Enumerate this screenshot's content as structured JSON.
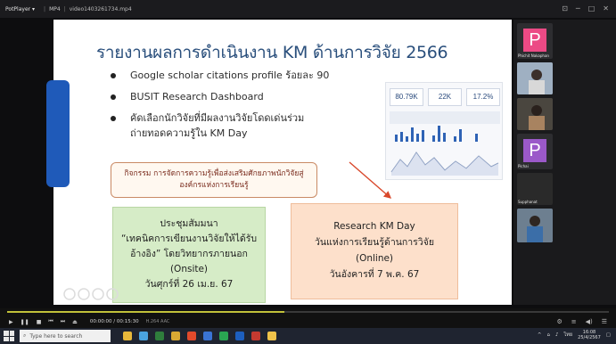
{
  "player": {
    "app_name": "PotPlayer",
    "menu_arrow": "▾",
    "format": "MP4",
    "file_name": "video1403261734.mp4"
  },
  "window_controls": [
    "⊡",
    "─",
    "□",
    "✕"
  ],
  "slide": {
    "title": "รายงานผลการดำเนินงาน KM ด้านการวิจัย 2566",
    "bullets": [
      "Google scholar citations profile ร้อยละ 90",
      "BUSIT Research Dashboard",
      "คัดเลือกนักวิจัยที่มีผลงานวิจัยโดดเด่นร่วม",
      "ถ่ายทอดความรู้ใน KM Day"
    ],
    "dashboard_kpis": [
      "80.79K",
      "22K",
      "17.2%"
    ],
    "activity_box": {
      "line1": "กิจกรรม การจัดการความรู้เพื่อส่งเสริมศักยภาพนักวิจัยสู่",
      "line2": "องค์กรแห่งการเรียนรู้"
    },
    "green_box": [
      "ประชุมสัมมนา",
      "“เทคนิคการเขียนงานวิจัยให้ได้รับ",
      "อ้างอิง” โดยวิทยากรภายนอก",
      "(Onsite)",
      "วันศุกร์ที่ 26 เม.ย. 67"
    ],
    "peach_box": [
      "Research KM Day",
      "วันแห่งการเรียนรู้ด้านการวิจัย",
      "(Online)",
      "วันอังคารที่ 7 พ.ค. 67"
    ]
  },
  "participants": [
    {
      "initial": "P",
      "label": "Phichit Nakaphan",
      "color": "#ec4a85"
    },
    {
      "initial": "",
      "label": "",
      "color": "#6f7f94"
    },
    {
      "initial": "",
      "label": "",
      "color": "#3c3a36"
    },
    {
      "initial": "P",
      "label": "Pichai",
      "color": "#9b59c9"
    },
    {
      "initial": "",
      "label": "Supphanat",
      "color": "#2a2a2a"
    },
    {
      "initial": "",
      "label": "",
      "color": "#5a6b7c"
    }
  ],
  "playback": {
    "progress": 0.46,
    "time": "00:00:00 / 00:15:30",
    "meta": "H.264  AAC"
  },
  "taskbar": {
    "search_placeholder": "Type here to search",
    "clock_time": "16:08",
    "clock_date": "25/4/2567",
    "lang": "ไทย"
  },
  "colors": {
    "title": "#2a4f7c",
    "accent_bar": "#1f5ab9",
    "green_box": "#d6ecc7",
    "peach_box": "#fde0cb",
    "arrow": "#d9482b"
  }
}
